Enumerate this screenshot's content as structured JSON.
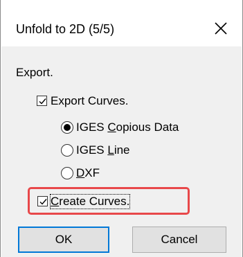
{
  "window": {
    "title": "Unfold to 2D (5/5)",
    "close_glyph": "✕"
  },
  "section": {
    "label": "Export."
  },
  "export_curves": {
    "label": "Export Curves.",
    "checked": true
  },
  "format_options": [
    {
      "label_pre": "IGES ",
      "accel": "C",
      "label_post": "opious Data",
      "selected": true
    },
    {
      "label_pre": "IGES ",
      "accel": "L",
      "label_post": "ine",
      "selected": false
    },
    {
      "label_pre": "",
      "accel": "D",
      "label_post": "XF",
      "selected": false
    }
  ],
  "create_curves": {
    "label_pre": "",
    "accel": "C",
    "label_post": "reate Curves.",
    "checked": true
  },
  "buttons": {
    "ok": "OK",
    "cancel": "Cancel"
  },
  "colors": {
    "highlight": "#e8484a",
    "default_button_border": "#0078d7",
    "dialog_background": "#f0f0f0"
  },
  "icons": {
    "close": "close-icon",
    "check": "checkmark-icon",
    "radio": "radio-dot-icon"
  }
}
